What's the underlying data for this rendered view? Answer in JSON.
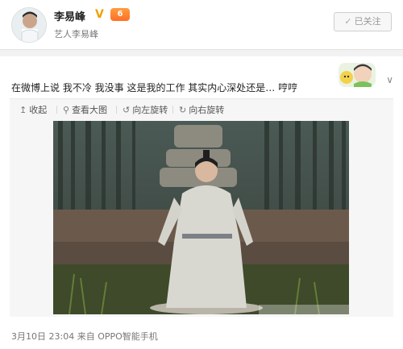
{
  "profile": {
    "name": "李易峰",
    "verified_badge": "V",
    "vip_badge": "6",
    "verification": "艺人李易峰",
    "follow_button": "已关注",
    "avatar_icon": "avatar-portrait-icon"
  },
  "post": {
    "text": "在微博上说 我不冷 我没事 这是我的工作 其实内心深处还是… 哼哼",
    "sticker_icon": "cartoon-sticker-icon",
    "more_icon": "chevron-down-icon"
  },
  "image_toolbar": {
    "collapse": "收起",
    "view_large": "查看大图",
    "rotate_left": "向左旋转",
    "rotate_right": "向右旋转"
  },
  "photo": {
    "description_icon": "drama-still-image"
  },
  "meta": {
    "time": "3月10日 23:04",
    "source_prefix": "来自",
    "source": "OPPO智能手机"
  },
  "colors": {
    "verified": "#f0a100",
    "vip": "#ff7a2d",
    "link": "#3f6fb0"
  }
}
